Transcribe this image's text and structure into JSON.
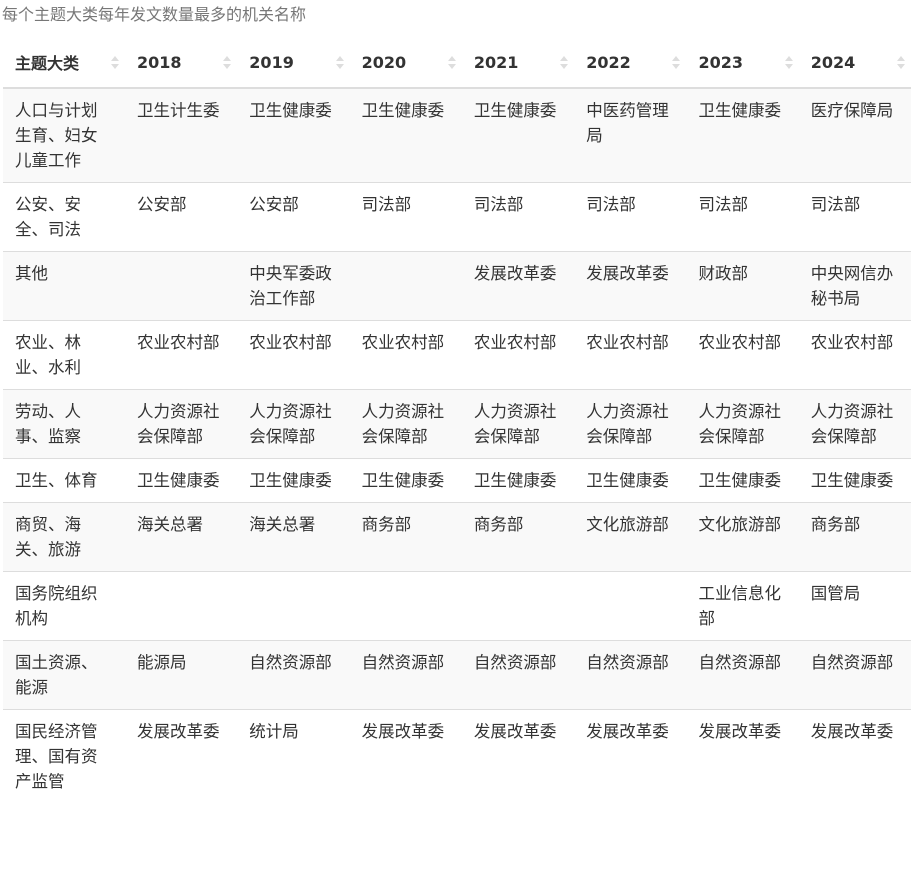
{
  "caption": "每个主题大类每年发文数量最多的机关名称",
  "chart_data": {
    "type": "table",
    "title": "每个主题大类每年发文数量最多的机关名称",
    "columns": [
      "主题大类",
      "2018",
      "2019",
      "2020",
      "2021",
      "2022",
      "2023",
      "2024"
    ],
    "rows": [
      [
        "人口与计划生育、妇女儿童工作",
        "卫生计生委",
        "卫生健康委",
        "卫生健康委",
        "卫生健康委",
        "中医药管理局",
        "卫生健康委",
        "医疗保障局"
      ],
      [
        "公安、安全、司法",
        "公安部",
        "公安部",
        "司法部",
        "司法部",
        "司法部",
        "司法部",
        "司法部"
      ],
      [
        "其他",
        "",
        "中央军委政治工作部",
        "",
        "发展改革委",
        "发展改革委",
        "财政部",
        "中央网信办秘书局"
      ],
      [
        "农业、林业、水利",
        "农业农村部",
        "农业农村部",
        "农业农村部",
        "农业农村部",
        "农业农村部",
        "农业农村部",
        "农业农村部"
      ],
      [
        "劳动、人事、监察",
        "人力资源社会保障部",
        "人力资源社会保障部",
        "人力资源社会保障部",
        "人力资源社会保障部",
        "人力资源社会保障部",
        "人力资源社会保障部",
        "人力资源社会保障部"
      ],
      [
        "卫生、体育",
        "卫生健康委",
        "卫生健康委",
        "卫生健康委",
        "卫生健康委",
        "卫生健康委",
        "卫生健康委",
        "卫生健康委"
      ],
      [
        "商贸、海关、旅游",
        "海关总署",
        "海关总署",
        "商务部",
        "商务部",
        "文化旅游部",
        "文化旅游部",
        "商务部"
      ],
      [
        "国务院组织机构",
        "",
        "",
        "",
        "",
        "",
        "工业信息化部",
        "国管局"
      ],
      [
        "国土资源、能源",
        "能源局",
        "自然资源部",
        "自然资源部",
        "自然资源部",
        "自然资源部",
        "自然资源部",
        "自然资源部"
      ],
      [
        "国民经济管理、国有资产监管",
        "发展改革委",
        "统计局",
        "发展改革委",
        "发展改革委",
        "发展改革委",
        "发展改革委",
        "发展改革委"
      ]
    ]
  },
  "colors": {
    "header_text": "#333333",
    "cell_text": "#333333",
    "caption_text": "#777777",
    "stripe": "#f9f9f9",
    "border": "#dddddd",
    "sort_icon": "#dddddd"
  },
  "icons": {
    "sort": "sort-both-icon"
  }
}
